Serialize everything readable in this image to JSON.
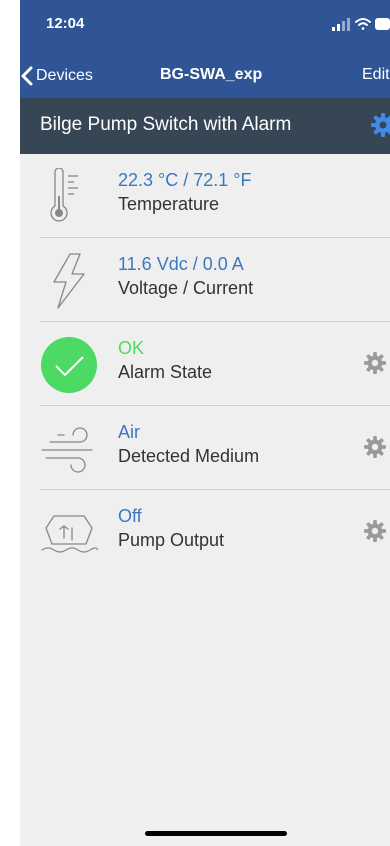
{
  "status_bar": {
    "time": "12:04"
  },
  "nav": {
    "back_label": "Devices",
    "title": "BG-SWA_exp",
    "edit_label": "Edit"
  },
  "header": {
    "title": "Bilge Pump Switch with Alarm"
  },
  "colors": {
    "nav_blue": "#2f5597",
    "header_dark": "#374655",
    "value_blue": "#3b78c0",
    "ok_green": "#4cd964"
  },
  "rows": [
    {
      "value": "22.3 °C / 72.1 °F",
      "label": "Temperature",
      "icon": "thermometer-icon",
      "has_settings": false
    },
    {
      "value": "11.6 Vdc / 0.0 A",
      "label": "Voltage / Current",
      "icon": "lightning-icon",
      "has_settings": false
    },
    {
      "value": "OK",
      "label": "Alarm State",
      "icon": "check-circle-icon",
      "has_settings": true
    },
    {
      "value": "Air",
      "label": "Detected Medium",
      "icon": "wind-icon",
      "has_settings": true
    },
    {
      "value": "Off",
      "label": "Pump Output",
      "icon": "pump-icon",
      "has_settings": true
    }
  ]
}
